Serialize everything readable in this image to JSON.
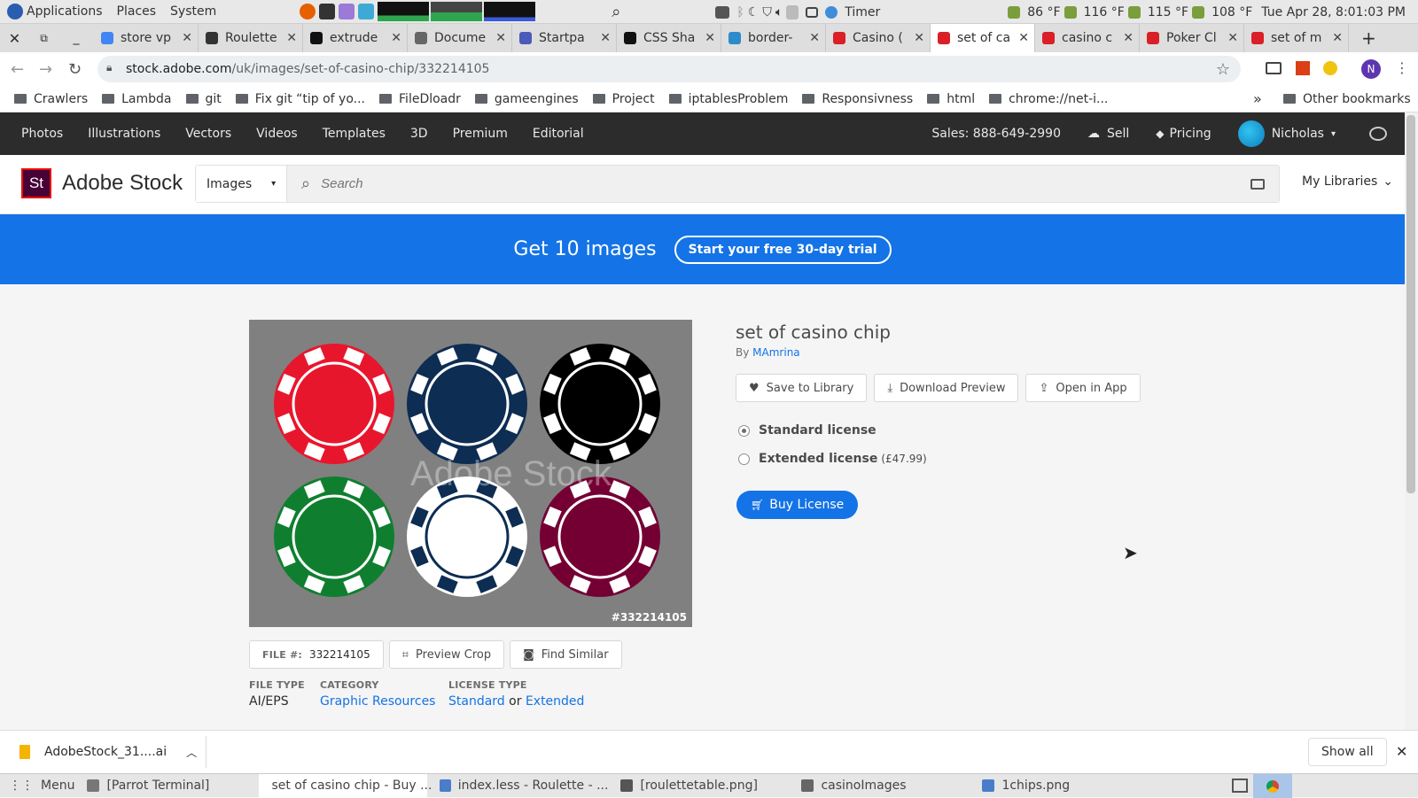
{
  "system": {
    "applications": "Applications",
    "places": "Places",
    "system": "System",
    "timer": "Timer",
    "temps": [
      "86 °F",
      "116 °F",
      "115 °F",
      "108 °F"
    ],
    "clock": "Tue Apr 28,  8:01:03 PM"
  },
  "tabs": [
    {
      "label": "store vp",
      "fav": "#4285f4"
    },
    {
      "label": "Roulette",
      "fav": "#333"
    },
    {
      "label": "extrude",
      "fav": "#111"
    },
    {
      "label": "Docume",
      "fav": "#666"
    },
    {
      "label": "Startpa",
      "fav": "#4b5bb8"
    },
    {
      "label": "CSS Sha",
      "fav": "#111"
    },
    {
      "label": "border-",
      "fav": "#2e8bc9"
    },
    {
      "label": "Casino (",
      "fav": "#da1f26"
    },
    {
      "label": "set of ca",
      "fav": "#da1f26"
    },
    {
      "label": "casino c",
      "fav": "#da1f26"
    },
    {
      "label": "Poker Cl",
      "fav": "#da1f26"
    },
    {
      "label": "set of m",
      "fav": "#da1f26"
    }
  ],
  "address": {
    "domain": "stock.adobe.com",
    "path": "/uk/images/set-of-casino-chip/332214105",
    "profile_initial": "N"
  },
  "bookmarks": [
    "Crawlers",
    "Lambda",
    "git",
    "Fix git “tip of yo...",
    "FileDloadr",
    "gameengines",
    "Project",
    "iptablesProblem",
    "Responsivness",
    "html",
    "chrome://net-i..."
  ],
  "bookmarks_more": "»",
  "bookmarks_other": "Other bookmarks",
  "adobe_nav": {
    "items": [
      "Photos",
      "Illustrations",
      "Vectors",
      "Videos",
      "Templates",
      "3D",
      "Premium",
      "Editorial"
    ],
    "sales": "Sales: 888-649-2990",
    "sell": "Sell",
    "pricing": "Pricing",
    "user": "Nicholas"
  },
  "header": {
    "logo_mark": "St",
    "logo_text": "Adobe Stock",
    "type_select": "Images",
    "search_placeholder": "Search",
    "my_libraries": "My Libraries"
  },
  "banner": {
    "text": "Get 10 images",
    "cta": "Start your free 30-day trial"
  },
  "asset": {
    "title": "set of casino chip",
    "by_label": "By",
    "author": "MAmrina",
    "watermark": "Adobe Stock",
    "image_id": "#332214105",
    "chip_colors": [
      "#e8162c",
      "#0d2d52",
      "#000000",
      "#0f7f2f",
      "#ffffff",
      "#740033"
    ],
    "save": "Save to Library",
    "download": "Download Preview",
    "open": "Open in App",
    "standard": "Standard license",
    "extended": "Extended license",
    "extended_price": "(£47.99)",
    "buy": "Buy License",
    "file_label": "FILE #:",
    "file_id": "332214105",
    "preview_crop": "Preview Crop",
    "find_similar": "Find Similar",
    "meta": {
      "file_type_h": "FILE TYPE",
      "file_type": "AI/EPS",
      "category_h": "CATEGORY",
      "category": "Graphic Resources",
      "license_h": "LICENSE TYPE",
      "lic_standard": "Standard",
      "lic_or": "or",
      "lic_extended": "Extended"
    }
  },
  "download_bar": {
    "file": "AdobeStock_31....ai",
    "show_all": "Show all"
  },
  "taskbar": {
    "menu": "Menu",
    "items": [
      "[Parrot Terminal]",
      "set of casino chip - Buy ...",
      "index.less - Roulette - ...",
      "[roulettetable.png]",
      "casinoImages",
      "1chips.png"
    ]
  }
}
